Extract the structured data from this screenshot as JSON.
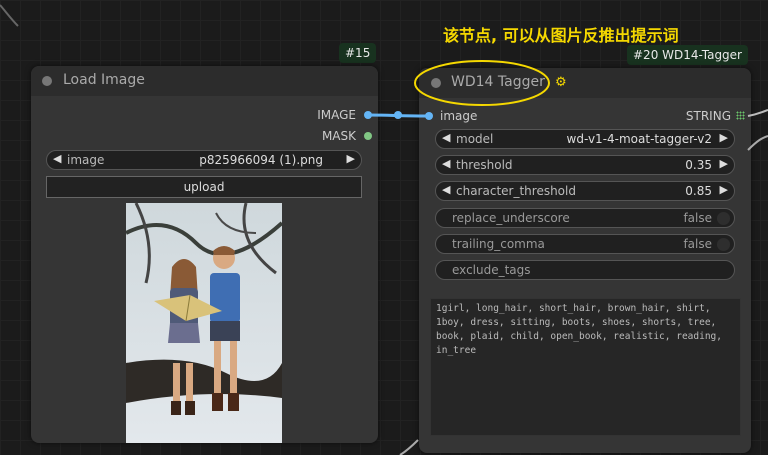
{
  "annotation": "该节点, 可以从图片反推出提示词",
  "load_image_node": {
    "id_badge": "#15",
    "title": "Load Image",
    "outputs": [
      "IMAGE",
      "MASK"
    ],
    "image_field": {
      "label": "image",
      "value": "p825966094 (1).png"
    },
    "upload_label": "upload"
  },
  "tagger_node": {
    "id_badge": "#20 WD14-Tagger",
    "title": "WD14 Tagger",
    "input_label": "image",
    "output_label": "STRING",
    "widgets": {
      "model": {
        "label": "model",
        "value": "wd-v1-4-moat-tagger-v2"
      },
      "threshold": {
        "label": "threshold",
        "value": "0.35"
      },
      "character_threshold": {
        "label": "character_threshold",
        "value": "0.85"
      },
      "replace_underscore": {
        "label": "replace_underscore",
        "value": "false"
      },
      "trailing_comma": {
        "label": "trailing_comma",
        "value": "false"
      },
      "exclude_tags": {
        "label": "exclude_tags"
      }
    },
    "output_text": "1girl, long_hair, short_hair, brown_hair, shirt, 1boy, dress, sitting, boots, shoes, shorts, tree, book, plaid, child, open_book, realistic, reading, in_tree"
  },
  "colors": {
    "accent_link": "#64b5f6",
    "highlight": "#f5d800",
    "mask_socket": "#81c784",
    "string_socket": "#6ac56a"
  }
}
